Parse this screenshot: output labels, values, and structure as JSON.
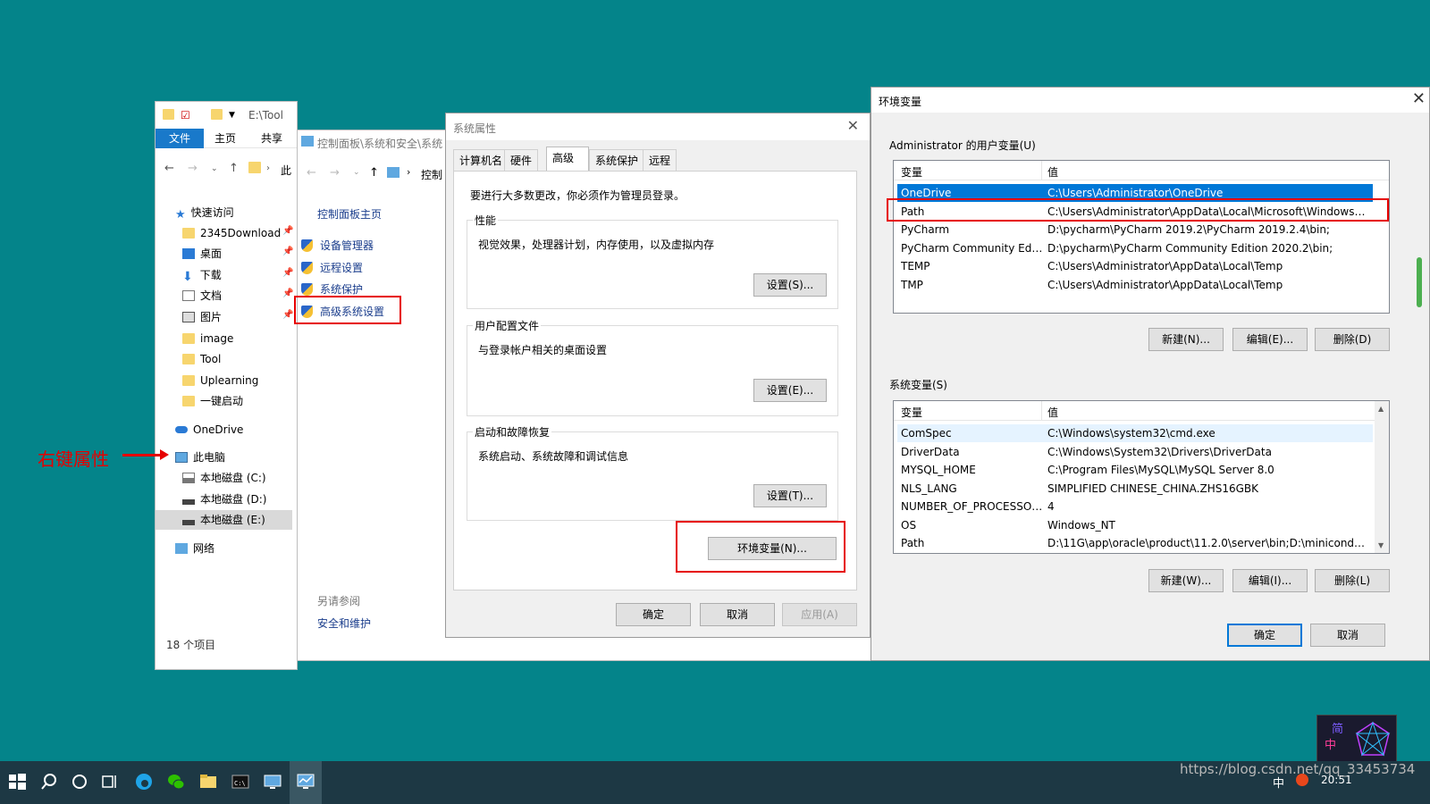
{
  "explorer": {
    "path": "E:\\Tool",
    "ribbon": {
      "file": "文件",
      "home": "主页",
      "share": "共享"
    },
    "addr_partial": "此",
    "nav": {
      "quick_access": "快速访问",
      "items": [
        "2345Download",
        "桌面",
        "下载",
        "文档",
        "图片",
        "image",
        "Tool",
        "Uplearning",
        "一键启动"
      ],
      "onedrive": "OneDrive",
      "this_pc": "此电脑",
      "drives": [
        "本地磁盘 (C:)",
        "本地磁盘 (D:)",
        "本地磁盘 (E:)"
      ],
      "network": "网络"
    },
    "status": "18 个项目"
  },
  "annotation": "右键属性",
  "cpanel": {
    "title": "控制面板\\系统和安全\\系统",
    "addr_partial": "控制",
    "home": "控制面板主页",
    "links": [
      "设备管理器",
      "远程设置",
      "系统保护",
      "高级系统设置"
    ],
    "see_also": "另请参阅",
    "security": "安全和维护"
  },
  "sysprops": {
    "title": "系统属性",
    "tabs": [
      "计算机名",
      "硬件",
      "高级",
      "系统保护",
      "远程"
    ],
    "admin_note": "要进行大多数更改，你必须作为管理员登录。",
    "perf": {
      "label": "性能",
      "desc": "视觉效果，处理器计划，内存使用，以及虚拟内存",
      "btn": "设置(S)..."
    },
    "profile": {
      "label": "用户配置文件",
      "desc": "与登录帐户相关的桌面设置",
      "btn": "设置(E)..."
    },
    "startup": {
      "label": "启动和故障恢复",
      "desc": "系统启动、系统故障和调试信息",
      "btn": "设置(T)..."
    },
    "env_btn": "环境变量(N)...",
    "ok": "确定",
    "cancel": "取消",
    "apply": "应用(A)"
  },
  "envvars": {
    "title": "环境变量",
    "user_label": "Administrator 的用户变量(U)",
    "sys_label": "系统变量(S)",
    "col_var": "变量",
    "col_val": "值",
    "user_vars": [
      {
        "n": "OneDrive",
        "v": "C:\\Users\\Administrator\\OneDrive"
      },
      {
        "n": "Path",
        "v": "C:\\Users\\Administrator\\AppData\\Local\\Microsoft\\WindowsA..."
      },
      {
        "n": "PyCharm",
        "v": "D:\\pycharm\\PyCharm 2019.2\\PyCharm 2019.2.4\\bin;"
      },
      {
        "n": "PyCharm Community Editi...",
        "v": "D:\\pycharm\\PyCharm Community Edition 2020.2\\bin;"
      },
      {
        "n": "TEMP",
        "v": "C:\\Users\\Administrator\\AppData\\Local\\Temp"
      },
      {
        "n": "TMP",
        "v": "C:\\Users\\Administrator\\AppData\\Local\\Temp"
      }
    ],
    "sys_vars": [
      {
        "n": "ComSpec",
        "v": "C:\\Windows\\system32\\cmd.exe"
      },
      {
        "n": "DriverData",
        "v": "C:\\Windows\\System32\\Drivers\\DriverData"
      },
      {
        "n": "MYSQL_HOME",
        "v": "C:\\Program Files\\MySQL\\MySQL Server 8.0"
      },
      {
        "n": "NLS_LANG",
        "v": "SIMPLIFIED CHINESE_CHINA.ZHS16GBK"
      },
      {
        "n": "NUMBER_OF_PROCESSORS",
        "v": "4"
      },
      {
        "n": "OS",
        "v": "Windows_NT"
      },
      {
        "n": "Path",
        "v": "D:\\11G\\app\\oracle\\product\\11.2.0\\server\\bin;D:\\miniconda;D..."
      }
    ],
    "user_btns": [
      "新建(N)...",
      "编辑(E)...",
      "删除(D)"
    ],
    "sys_btns": [
      "新建(W)...",
      "编辑(I)...",
      "删除(L)"
    ],
    "ok": "确定",
    "cancel": "取消"
  },
  "taskbar": {
    "time": "20:51",
    "ime": "中"
  },
  "watermark": "https://blog.csdn.net/qq_33453734",
  "ime_widget": {
    "top": "简",
    "bottom": "中"
  },
  "colors": {
    "desktop": "#04848a",
    "accent": "#0078d7",
    "highlight": "#e60000"
  }
}
